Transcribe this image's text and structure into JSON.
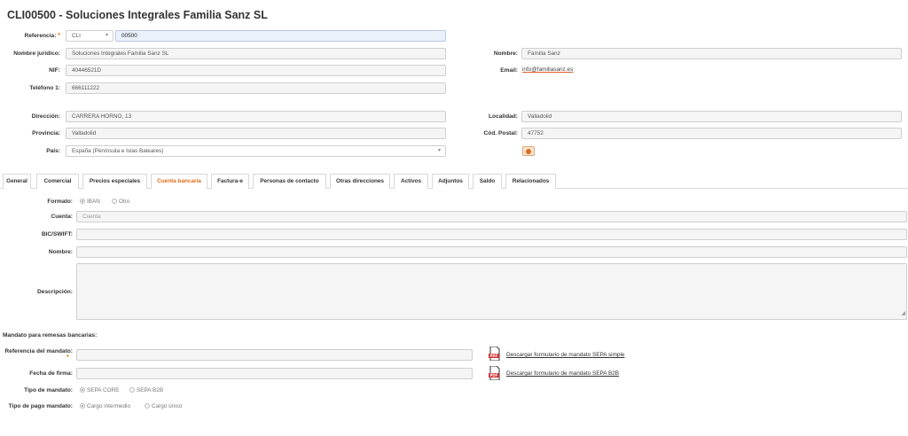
{
  "page_title": "CLI00500 - Soluciones Integrales Familia Sanz SL",
  "header": {
    "referencia": {
      "label": "Referencia:",
      "required_mark": "*",
      "prefix": "CLI",
      "value": "00500"
    },
    "nombre_juridico": {
      "label": "Nombre jurídico:",
      "value": "Soluciones Integrales Familia Sanz SL"
    },
    "nif": {
      "label": "NIF:",
      "value": "40446521D"
    },
    "telefono": {
      "label": "Teléfono 1:",
      "value": "666111222"
    },
    "nombre": {
      "label": "Nombre:",
      "value": "Familia Sanz"
    },
    "email": {
      "label": "Email:",
      "value": "info@familiasanz.es"
    },
    "direccion": {
      "label": "Dirección:",
      "value": "CARRERA HORNO, 13"
    },
    "provincia": {
      "label": "Provincia:",
      "value": "Valladolid"
    },
    "pais": {
      "label": "País:",
      "value": "España (Península e Islas Baleares)"
    },
    "localidad": {
      "label": "Localidad:",
      "value": "Valladolid"
    },
    "cod_postal": {
      "label": "Cód. Postal:",
      "value": "47752"
    }
  },
  "tabs": [
    {
      "label": "General",
      "active": false
    },
    {
      "label": "Comercial",
      "active": false
    },
    {
      "label": "Precios especiales",
      "active": false
    },
    {
      "label": "Cuenta bancaria",
      "active": true
    },
    {
      "label": "Factura-e",
      "active": false
    },
    {
      "label": "Personas de contacto",
      "active": false
    },
    {
      "label": "Otras direcciones",
      "active": false
    },
    {
      "label": "Activos",
      "active": false
    },
    {
      "label": "Adjuntos",
      "active": false
    },
    {
      "label": "Saldo",
      "active": false
    },
    {
      "label": "Relacionados",
      "active": false
    }
  ],
  "cuenta": {
    "formato_label": "Formato:",
    "formato_options": [
      "IBAN",
      "Otro"
    ],
    "formato_selected": "IBAN",
    "cuenta_label": "Cuenta:",
    "cuenta_placeholder": "Cuenta",
    "bic_label": "BIC/SWIFT:",
    "nombre_label": "Nombre:",
    "descripcion_label": "Descripción:"
  },
  "mandato": {
    "section_title": "Mandato para remesas bancarias:",
    "referencia_label": "Referencia del mandato:",
    "required_mark": "*",
    "fecha_label": "Fecha de firma:",
    "tipo_label": "Tipo de mandato:",
    "tipo_options": [
      "SEPA CORE",
      "SEPA B2B"
    ],
    "tipo_selected": "SEPA CORE",
    "pago_label": "Tipo de pago mandato:",
    "pago_options": [
      "Cargo intermedio",
      "Cargo único"
    ],
    "pago_selected": "Cargo intermedio",
    "link_simple": "Descargar formulario de mandato SEPA simple",
    "link_b2b": "Descargar formulario de mandato SEPA B2B",
    "pdf_text": "PDF"
  },
  "colors": {
    "accent": "#e06b1a",
    "pdf_red": "#d32f2f"
  },
  "icons": {
    "dropdown": "chevron-down-icon",
    "map": "map-pin-icon",
    "pdf": "pdf-file-icon"
  }
}
